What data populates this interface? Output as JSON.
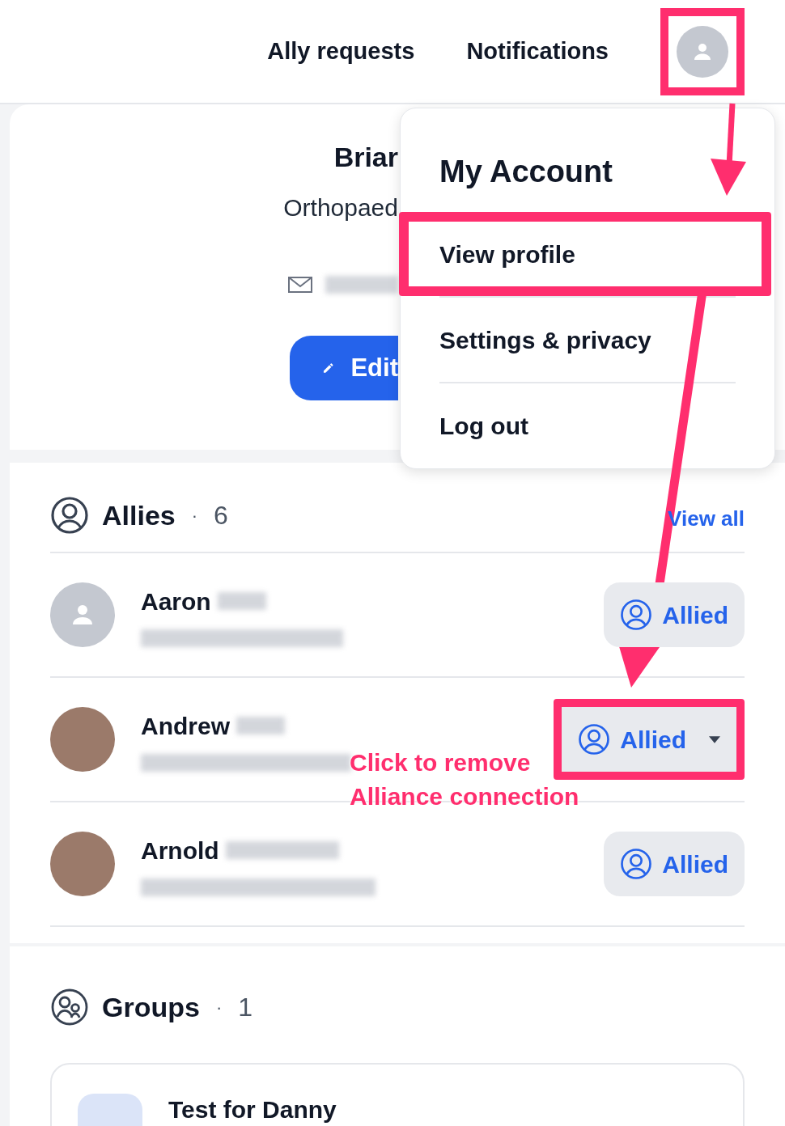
{
  "nav": {
    "links": [
      {
        "label": "Ally requests"
      },
      {
        "label": "Notifications"
      }
    ],
    "avatar": {
      "highlighted": true
    }
  },
  "profile": {
    "name": "Briar",
    "title": "Orthopaed",
    "edit_button": "Edit"
  },
  "account_menu": {
    "title": "My Account",
    "items": [
      {
        "label": "View profile",
        "highlighted": true
      },
      {
        "label": "Settings & privacy",
        "highlighted": false
      },
      {
        "label": "Log out",
        "highlighted": false
      }
    ]
  },
  "allies": {
    "title": "Allies",
    "separator": "·",
    "count": "6",
    "view_all": "View all",
    "rows": [
      {
        "name": "Aaron",
        "kind": "placeholder",
        "button": "Allied",
        "dropdown": false,
        "highlighted": false
      },
      {
        "name": "Andrew",
        "kind": "photo",
        "button": "Allied",
        "dropdown": true,
        "highlighted": true
      },
      {
        "name": "Arnold",
        "kind": "photo",
        "button": "Allied",
        "dropdown": false,
        "highlighted": false
      }
    ]
  },
  "annotation": {
    "lines": [
      "Click to remove",
      "Alliance connection"
    ]
  },
  "groups": {
    "title": "Groups",
    "separator": "·",
    "count": "1",
    "items": [
      {
        "name": "Test for Danny"
      }
    ]
  }
}
